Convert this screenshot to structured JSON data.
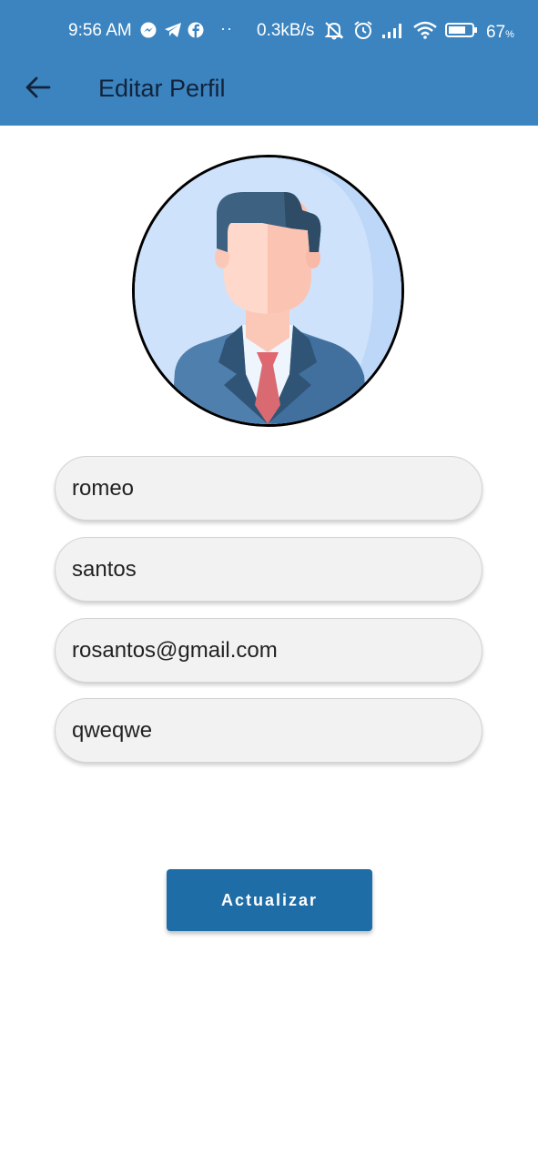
{
  "status_bar": {
    "time": "9:56 AM",
    "net_speed": "0.3kB/s",
    "battery_percent": "67",
    "battery_suffix": "%",
    "dots": "··",
    "icons": [
      "messenger-icon",
      "telegram-icon",
      "facebook-icon",
      "mute-notification-icon",
      "alarm-icon",
      "signal-icon",
      "wifi-icon",
      "battery-icon"
    ]
  },
  "app_bar": {
    "title": "Editar Perfil",
    "back_icon": "arrow-left-icon",
    "background": "#3b84c0"
  },
  "form": {
    "first_name": "romeo",
    "last_name": "santos",
    "email": "rosantos@gmail.com",
    "password": "qweqwe"
  },
  "update_button": {
    "label": "Actualizar",
    "color": "#1e6da6"
  }
}
